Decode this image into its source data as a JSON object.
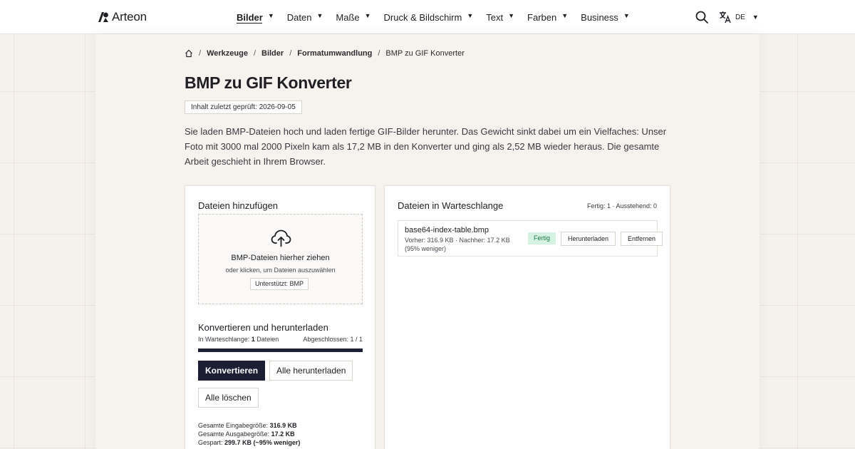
{
  "header": {
    "logo": "Arteon",
    "nav": [
      {
        "label": "Bilder",
        "active": true
      },
      {
        "label": "Daten",
        "active": false
      },
      {
        "label": "Maße",
        "active": false
      },
      {
        "label": "Druck & Bildschirm",
        "active": false
      },
      {
        "label": "Text",
        "active": false
      },
      {
        "label": "Farben",
        "active": false
      },
      {
        "label": "Business",
        "active": false
      }
    ],
    "language": "DE"
  },
  "breadcrumb": {
    "items": [
      "Werkzeuge",
      "Bilder",
      "Formatumwandlung"
    ],
    "current": "BMP zu GIF Konverter"
  },
  "page": {
    "title": "BMP zu GIF Konverter",
    "checked": "Inhalt zuletzt geprüft: 2026-09-05",
    "intro": "Sie laden BMP-Dateien hoch und laden fertige GIF-Bilder herunter. Das Gewicht sinkt dabei um ein Vielfaches: Unser Foto mit 3000 mal 2000 Pixeln kam als 17,2 MB in den Konverter und ging als 2,52 MB wieder heraus. Die gesamte Arbeit geschieht in Ihrem Browser."
  },
  "upload": {
    "heading": "Dateien hinzufügen",
    "drop_title": "BMP-Dateien hierher ziehen",
    "drop_sub": "oder klicken, um Dateien auszuwählen",
    "supported": "Unterstützt: BMP"
  },
  "convert": {
    "heading": "Konvertieren und herunterladen",
    "queue_label": "In Warteschlange:",
    "queue_count": "1",
    "queue_unit": "Dateien",
    "done_label": "Abgeschlossen:",
    "done_value": "1 / 1",
    "progress": 1.0,
    "convert_button": "Konvertieren",
    "download_all_button": "Alle herunterladen",
    "clear_button": "Alle löschen",
    "input_size_label": "Gesamte Eingabegröße:",
    "input_size": "316.9 KB",
    "output_size_label": "Gesamte Ausgabegröße:",
    "output_size": "17.2 KB",
    "saved_label": "Gespart:",
    "saved": "299.7 KB (~95% weniger)"
  },
  "queue": {
    "heading": "Dateien in Warteschlange",
    "status": "Fertig: 1 · Ausstehend: 0",
    "files": [
      {
        "name": "base64-index-table.bmp",
        "meta": "Vorher: 316.9 KB · Nachher: 17.2 KB (95% weniger)",
        "status": "Fertig",
        "download": "Herunterladen",
        "remove": "Entfernen"
      }
    ]
  },
  "colors": {
    "primary": "#1c1e33",
    "success_bg": "#d6f2e2",
    "success_text": "#1d7a48"
  }
}
